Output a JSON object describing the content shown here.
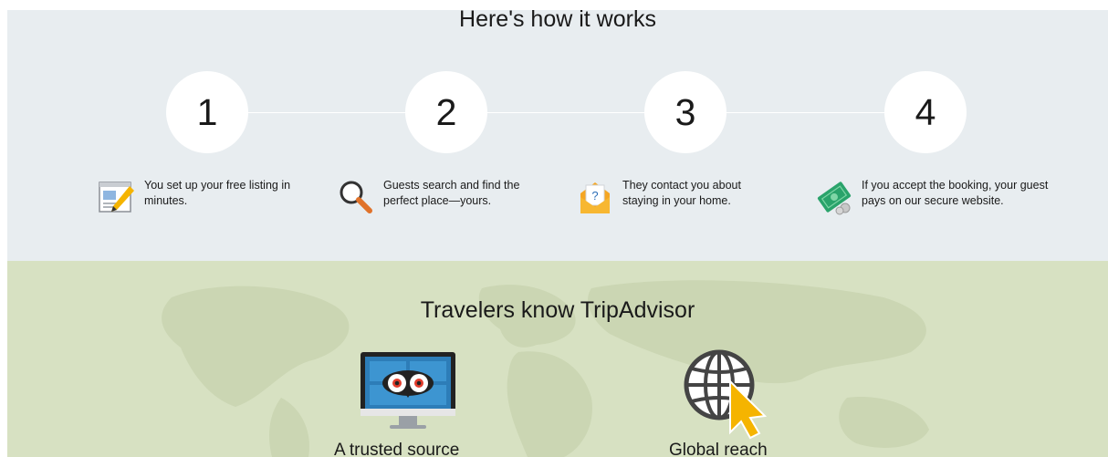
{
  "how_it_works": {
    "title": "Here's how it works",
    "steps": [
      {
        "number": "1",
        "icon": "listing-page-pen-icon",
        "text": "You set up your free listing in minutes."
      },
      {
        "number": "2",
        "icon": "magnifier-icon",
        "text": "Guests search and find the perfect place—yours."
      },
      {
        "number": "3",
        "icon": "envelope-question-icon",
        "text": "They contact you about staying in your home."
      },
      {
        "number": "4",
        "icon": "money-coins-icon",
        "text": "If you accept the booking, your guest pays on our secure website."
      }
    ]
  },
  "travelers": {
    "title": "Travelers know TripAdvisor",
    "features": [
      {
        "icon": "monitor-owl-icon",
        "label": "A trusted source"
      },
      {
        "icon": "globe-cursor-icon",
        "label": "Global reach"
      }
    ]
  },
  "colors": {
    "how_bg": "#e8edf0",
    "travelers_bg": "#d7e1c2",
    "circle_bg": "#ffffff",
    "accent_orange": "#f5a623",
    "accent_green": "#2aa36b"
  }
}
